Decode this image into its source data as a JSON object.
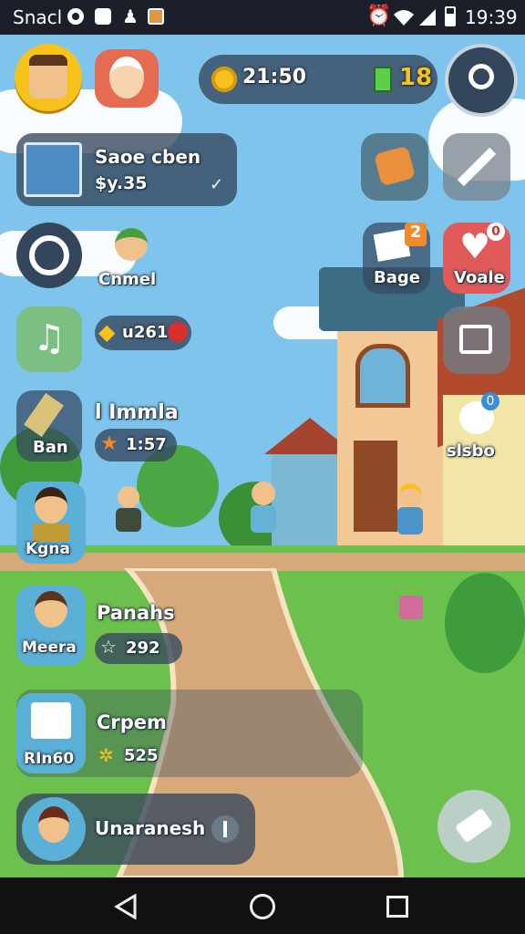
{
  "status_bar": {
    "left_text": "Snacl",
    "time": "19:39",
    "left_icons": [
      "circle-record-icon",
      "message-icon",
      "puzzle-icon",
      "image-icon"
    ],
    "right_icons": [
      "alarm-icon",
      "wifi-icon",
      "signal-icon",
      "battery-icon"
    ]
  },
  "hud": {
    "coins": "21:50",
    "gems": "18"
  },
  "quest_card": {
    "title": "Saoe cben",
    "value": "$y.35"
  },
  "left_column": {
    "friend_label": "Cnmel",
    "shield_value": "u2610",
    "item_title": "l Immla",
    "item_sub": "Ban",
    "item_timer": "1:57",
    "character_label": "Kgna"
  },
  "right_column": {
    "badge_label": "Bage",
    "badge_count": "2",
    "heart_label": "Voale",
    "heart_count": "0",
    "npc_label": "slsbo",
    "npc_count": "0"
  },
  "list_items": [
    {
      "title": "Panahs",
      "sub": "Meera",
      "value": "292"
    },
    {
      "title": "Crpem",
      "sub": "RIn60",
      "value": "525"
    }
  ],
  "bottom_bar": {
    "label": "Unaranesh"
  },
  "colors": {
    "sky": "#7ec4ec",
    "grass": "#6cc04e",
    "road": "#d6a97a",
    "panel": "#34465c",
    "accent_gold": "#f7c21b",
    "status_bar": "#1b1f2a"
  }
}
